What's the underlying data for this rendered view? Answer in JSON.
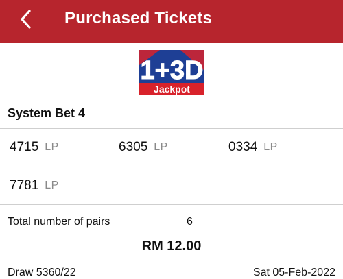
{
  "header": {
    "title": "Purchased Tickets",
    "background_color": "#b7252d"
  },
  "logo": {
    "main_text": "1+3D",
    "sub_text": "Jackpot",
    "colors": {
      "blue": "#1e3f95",
      "red": "#d8222b",
      "white": "#ffffff"
    }
  },
  "bet": {
    "title": "System Bet 4",
    "numbers": [
      {
        "value": "4715",
        "tag": "LP"
      },
      {
        "value": "6305",
        "tag": "LP"
      },
      {
        "value": "0334",
        "tag": "LP"
      },
      {
        "value": "7781",
        "tag": "LP"
      }
    ]
  },
  "summary": {
    "pairs_label": "Total number of pairs",
    "pairs_value": "6",
    "total_amount": "RM 12.00",
    "draw": "Draw 5360/22",
    "date": "Sat 05-Feb-2022"
  }
}
